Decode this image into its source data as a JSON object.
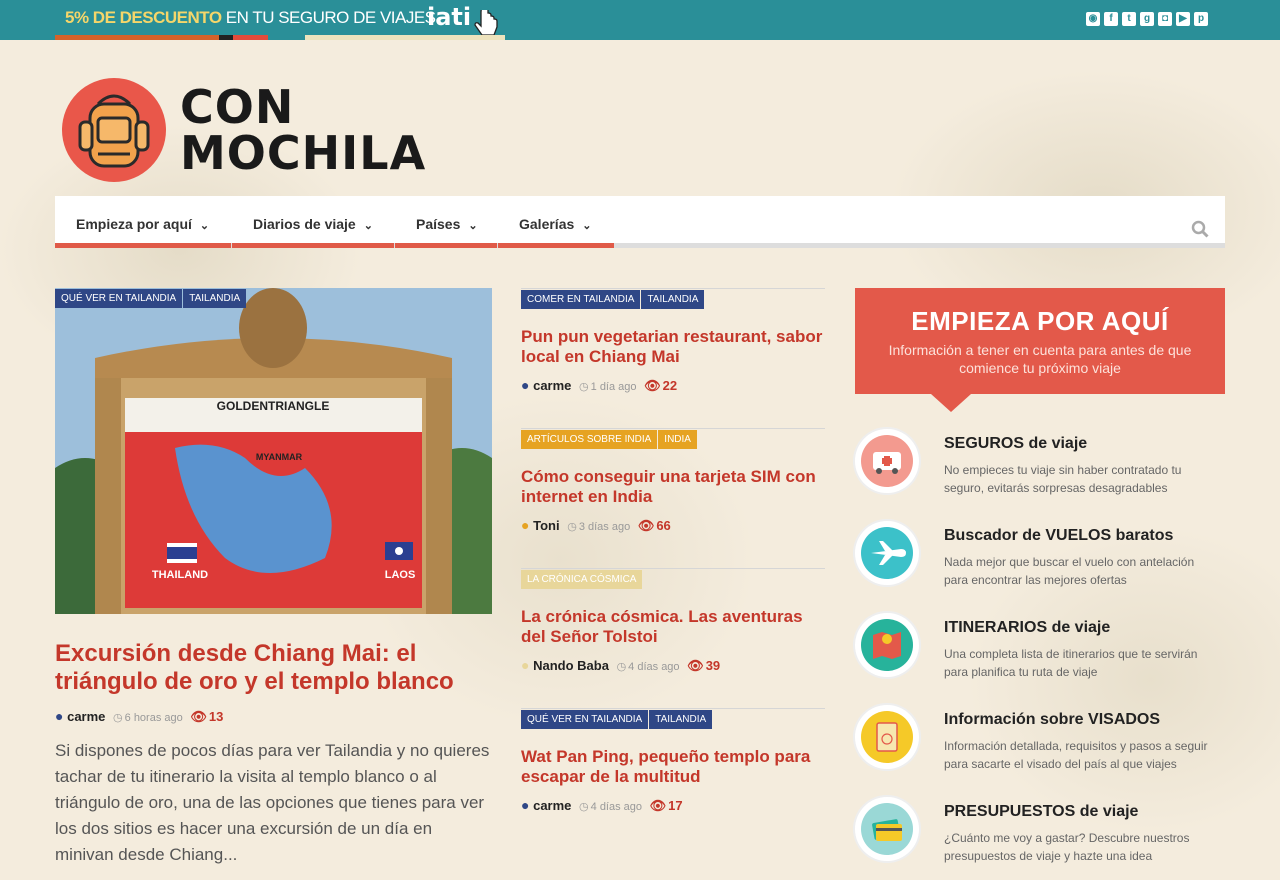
{
  "promo": {
    "highlight": "5% DE DESCUENTO",
    "rest": " EN TU SEGURO DE VIAJES",
    "brand": "iati"
  },
  "social_icons": [
    "rss-icon",
    "facebook-icon",
    "twitter-icon",
    "google-plus-icon",
    "instagram-icon",
    "youtube-icon",
    "pinterest-icon"
  ],
  "logo": {
    "line1": "CON",
    "line2": "MOCHILA"
  },
  "nav": {
    "items": [
      {
        "label": "Empieza por aquí"
      },
      {
        "label": "Diarios de viaje"
      },
      {
        "label": "Países"
      },
      {
        "label": "Galerías"
      }
    ]
  },
  "main_article": {
    "tags": [
      "QUÉ VER EN TAILANDIA",
      "TAILANDIA"
    ],
    "image_caption": "GOLDENTRIANGLE",
    "image_labels": [
      "MYANMAR",
      "THAILAND",
      "LAOS"
    ],
    "title": "Excursión desde Chiang Mai: el triángulo de oro y el templo blanco",
    "author": "carme",
    "time": "6 horas ago",
    "views": "13",
    "excerpt": "Si dispones de pocos días para ver Tailandia y no quieres tachar de tu itinerario la visita al templo blanco o al triángulo de oro, una de las opciones que tienes para ver los dos sitios es hacer una excursión de un día en minivan desde Chiang..."
  },
  "mid_articles": [
    {
      "tags": [
        "COMER EN TAILANDIA",
        "TAILANDIA"
      ],
      "tag_color": "blue",
      "title": "Pun pun vegetarian restaurant, sabor local en Chiang Mai",
      "author": "carme",
      "time": "1 día ago",
      "views": "22",
      "dot_color": "#2f4786"
    },
    {
      "tags": [
        "ARTÍCULOS SOBRE INDIA",
        "INDIA"
      ],
      "tag_color": "yellow",
      "title": "Cómo conseguir una tarjeta SIM con internet en India",
      "author": "Toni",
      "time": "3 días ago",
      "views": "66",
      "dot_color": "#e6a322"
    },
    {
      "tags": [
        "LA CRÓNICA CÓSMICA"
      ],
      "tag_color": "yellow",
      "title": "La crónica cósmica. Las aventuras del Señor Tolstoi",
      "author": "Nando Baba",
      "time": "4 días ago",
      "views": "39",
      "dot_color": "#e8d69a"
    },
    {
      "tags": [
        "QUÉ VER EN TAILANDIA",
        "TAILANDIA"
      ],
      "tag_color": "blue",
      "title": "Wat Pan Ping, pequeño templo para escapar de la multitud",
      "author": "carme",
      "time": "4 días ago",
      "views": "17",
      "dot_color": "#2f4786"
    }
  ],
  "sidebar": {
    "title": "EMPIEZA POR AQUÍ",
    "subtitle": "Información a tener en cuenta para antes de que comience tu próximo viaje",
    "items": [
      {
        "title": "SEGUROS de viaje",
        "desc": "No empieces tu viaje sin haber contratado tu seguro, evitarás sorpresas desagradables",
        "icon": "ambulance-icon",
        "color": "#f39a8f"
      },
      {
        "title": "Buscador de VUELOS baratos",
        "desc": "Nada mejor que buscar el vuelo con antelación para encontrar las mejores ofertas",
        "icon": "airplane-icon",
        "color": "#3cc1c9"
      },
      {
        "title": "ITINERARIOS de viaje",
        "desc": "Una completa lista de itinerarios que te servirán para planifica tu ruta de viaje",
        "icon": "map-icon",
        "color": "#27b39b"
      },
      {
        "title": "Información sobre VISADOS",
        "desc": "Información detallada, requisitos y pasos a seguir para sacarte el visado del país al que viajes",
        "icon": "passport-icon",
        "color": "#f5c928"
      },
      {
        "title": "PRESUPUESTOS de viaje",
        "desc": "¿Cuánto me voy a gastar? Descubre nuestros presupuestos de viaje y hazte una idea",
        "icon": "credit-card-icon",
        "color": "#9ad8d6"
      }
    ]
  }
}
